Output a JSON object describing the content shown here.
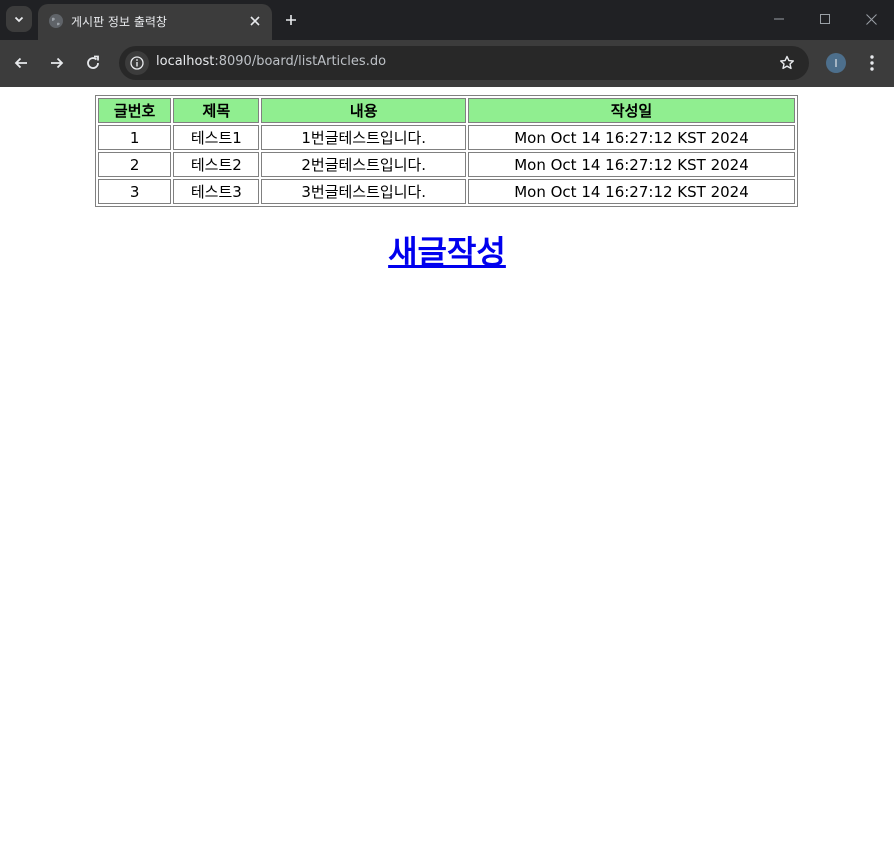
{
  "browser": {
    "tab": {
      "title": "게시판 정보 출력창"
    },
    "url": {
      "host": "localhost",
      "path": ":8090/board/listArticles.do"
    },
    "profile_initial": "I",
    "icons": [
      "chevron-down-icon",
      "globe-icon",
      "close-icon",
      "plus-icon",
      "minimize-icon",
      "maximize-icon",
      "back-arrow-icon",
      "forward-arrow-icon",
      "reload-icon",
      "info-icon",
      "star-icon",
      "kebab-menu-icon"
    ]
  },
  "board": {
    "headers": [
      "글번호",
      "제목",
      "내용",
      "작성일"
    ],
    "rows": [
      [
        "1",
        "테스트1",
        "1번글테스트입니다.",
        "Mon Oct 14 16:27:12 KST 2024"
      ],
      [
        "2",
        "테스트2",
        "2번글테스트입니다.",
        "Mon Oct 14 16:27:12 KST 2024"
      ],
      [
        "3",
        "테스트3",
        "3번글테스트입니다.",
        "Mon Oct 14 16:27:12 KST 2024"
      ]
    ],
    "header_color": "#90ee90"
  },
  "write_link": {
    "label": "새글작성",
    "color": "#0000ee"
  }
}
